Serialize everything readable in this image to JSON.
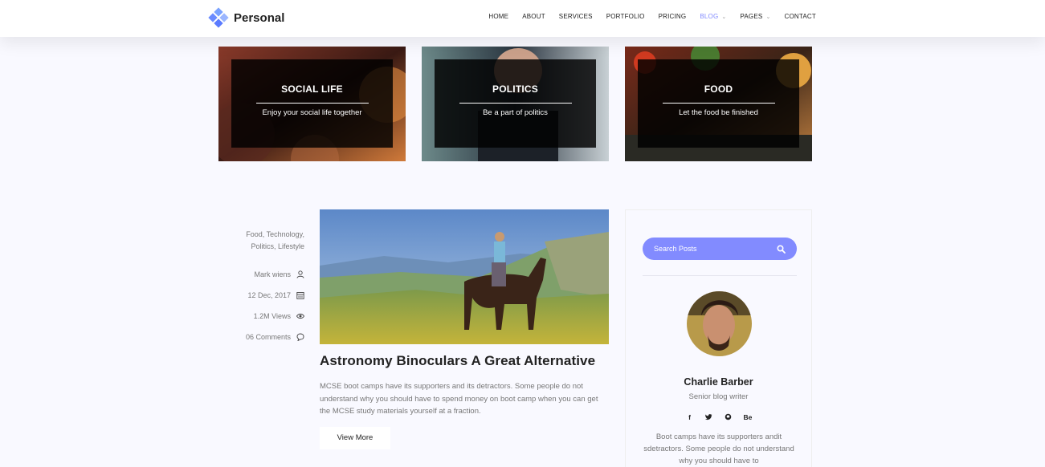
{
  "header": {
    "logo_text": "Personal",
    "nav": [
      {
        "label": "HOME"
      },
      {
        "label": "ABOUT"
      },
      {
        "label": "SERVICES"
      },
      {
        "label": "PORTFOLIO"
      },
      {
        "label": "PRICING"
      },
      {
        "label": "BLOG",
        "active": true,
        "dropdown": true
      },
      {
        "label": "PAGES",
        "dropdown": true
      },
      {
        "label": "CONTACT"
      }
    ]
  },
  "categories": [
    {
      "title": "SOCIAL LIFE",
      "subtitle": "Enjoy your social life together"
    },
    {
      "title": "POLITICS",
      "subtitle": "Be a part of politics"
    },
    {
      "title": "FOOD",
      "subtitle": "Let the food be finished"
    }
  ],
  "post": {
    "tags_line1": "Food, Technology,",
    "tags_line2": "Politics, Lifestyle",
    "author": "Mark wiens",
    "date": "12 Dec, 2017",
    "views": "1.2M Views",
    "comments": "06 Comments",
    "title": "Astronomy Binoculars A Great Alternative",
    "excerpt": "MCSE boot camps have its supporters and its detractors. Some people do not understand why you should have to spend money on boot camp when you can get the MCSE study materials yourself at a fraction.",
    "view_more_label": "View More"
  },
  "sidebar": {
    "search_placeholder": "Search Posts",
    "author_name": "Charlie Barber",
    "author_role": "Senior blog writer",
    "socials": [
      "f",
      "t",
      "gh",
      "Be"
    ],
    "author_bio": "Boot camps have its supporters andit sdetractors. Some people do not understand why you should have to"
  },
  "colors": {
    "accent": "#828bff",
    "page_bg": "#f9f9ff"
  }
}
